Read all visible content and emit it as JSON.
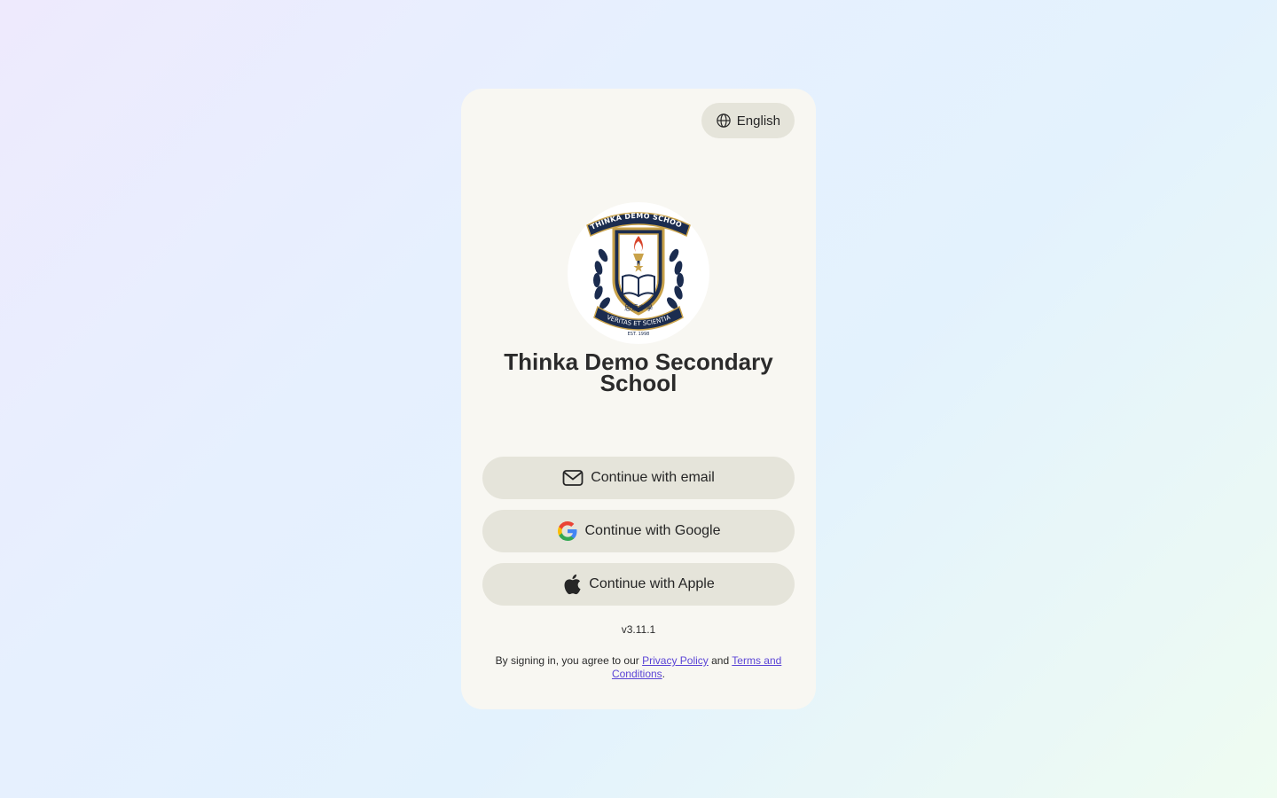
{
  "language": {
    "label": "English"
  },
  "school": {
    "name": "Thinka Demo Secondary School",
    "logo_text": {
      "top_ribbon": "THINKA DEMO SCHOOL",
      "chinese": "思達中學",
      "motto": "VERITAS ET SCIENTIA",
      "established": "EST. 1998"
    }
  },
  "auth": {
    "email_label": "Continue with email",
    "google_label": "Continue with Google",
    "apple_label": "Continue with Apple"
  },
  "version": "v3.11.1",
  "legal": {
    "prefix": "By signing in, you agree to our ",
    "privacy_label": "Privacy Policy",
    "middle": " and ",
    "terms_label": "Terms and Conditions",
    "suffix": "."
  },
  "colors": {
    "card": "#f8f7f2",
    "button": "#e5e4da",
    "link": "#5b45d6",
    "logo_navy": "#1b2c4f",
    "logo_gold": "#c9a24a"
  }
}
